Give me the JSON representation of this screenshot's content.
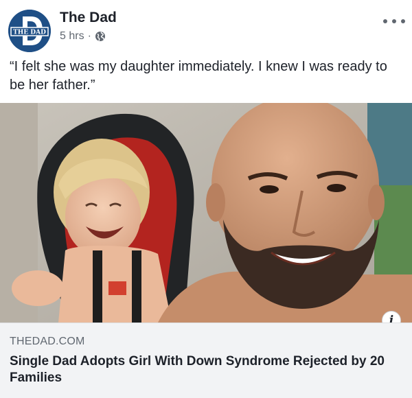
{
  "header": {
    "avatar_logo_text": "THE DAD",
    "page_name": "The Dad",
    "timestamp": "5 hrs",
    "separator": "·",
    "privacy_icon": "globe-icon",
    "more_icon": "more-options-icon"
  },
  "post": {
    "text": "“I felt she was my daughter immediately. I knew I was ready to be her father.”"
  },
  "photo": {
    "info_glyph": "i"
  },
  "link_preview": {
    "domain": "THEDAD.COM",
    "title": "Single Dad Adopts Girl With Down Syndrome Rejected by 20 Families"
  },
  "colors": {
    "brand": "#1f4f86",
    "text_primary": "#1d2129",
    "text_secondary": "#606770",
    "preview_bg": "#f2f3f5"
  }
}
